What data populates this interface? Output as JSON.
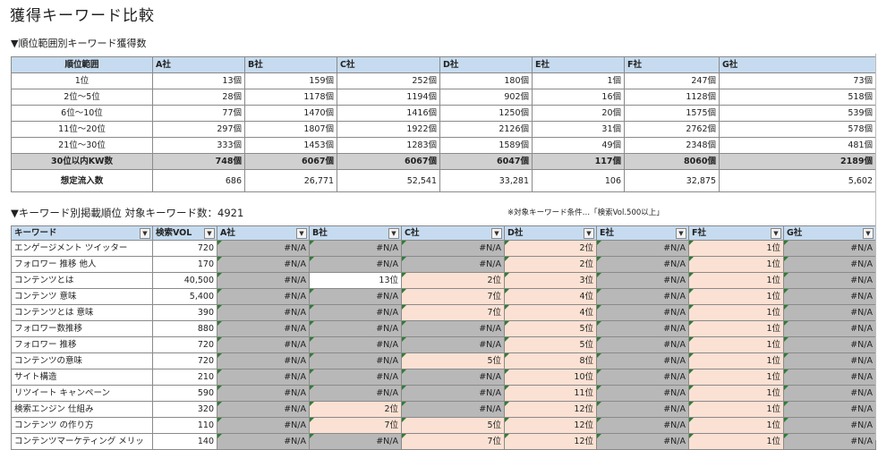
{
  "title": "獲得キーワード比較",
  "section1_title": "▼順位範囲別キーワード獲得数",
  "section2_title": "▼キーワード別掲載順位 対象キーワード数：4921",
  "note": "※対象キーワード条件…「検索Vol.500以上」",
  "colors": {
    "header": "#c6dbef",
    "na": "#b8b8b8",
    "rank": "#fbe1d3",
    "sum": "#d0d0d0"
  },
  "table1": {
    "headers": [
      "順位範囲",
      "A社",
      "B社",
      "C社",
      "D社",
      "E社",
      "F社",
      "G社"
    ],
    "rows": [
      [
        "1位",
        "13個",
        "159個",
        "252個",
        "180個",
        "1個",
        "247個",
        "73個"
      ],
      [
        "2位～5位",
        "28個",
        "1178個",
        "1194個",
        "902個",
        "16個",
        "1128個",
        "518個"
      ],
      [
        "6位～10位",
        "77個",
        "1470個",
        "1416個",
        "1250個",
        "20個",
        "1575個",
        "539個"
      ],
      [
        "11位～20位",
        "297個",
        "1807個",
        "1922個",
        "2126個",
        "31個",
        "2762個",
        "578個"
      ],
      [
        "21位～30位",
        "333個",
        "1453個",
        "1283個",
        "1589個",
        "49個",
        "2348個",
        "481個"
      ],
      [
        "30位以内KW数",
        "748個",
        "6067個",
        "6067個",
        "6047個",
        "117個",
        "8060個",
        "2189個"
      ],
      [
        "想定流入数",
        "686",
        "26,771",
        "52,541",
        "33,281",
        "106",
        "32,875",
        "5,602"
      ]
    ]
  },
  "table2": {
    "headers": [
      "キーワード",
      "検索VOL",
      "A社",
      "B社",
      "C社",
      "D社",
      "E社",
      "F社",
      "G社"
    ],
    "rows": [
      [
        "エンゲージメント ツイッター",
        "720",
        "#N/A",
        "#N/A",
        "#N/A",
        "2位",
        "#N/A",
        "1位",
        "#N/A"
      ],
      [
        "フォロワー 推移 他人",
        "170",
        "#N/A",
        "#N/A",
        "#N/A",
        "2位",
        "#N/A",
        "1位",
        "#N/A"
      ],
      [
        "コンテンツとは",
        "40,500",
        "#N/A",
        "13位",
        "2位",
        "3位",
        "#N/A",
        "1位",
        "#N/A"
      ],
      [
        "コンテンツ 意味",
        "5,400",
        "#N/A",
        "#N/A",
        "7位",
        "4位",
        "#N/A",
        "1位",
        "#N/A"
      ],
      [
        "コンテンツとは 意味",
        "390",
        "#N/A",
        "#N/A",
        "7位",
        "4位",
        "#N/A",
        "1位",
        "#N/A"
      ],
      [
        "フォロワー数推移",
        "880",
        "#N/A",
        "#N/A",
        "#N/A",
        "5位",
        "#N/A",
        "1位",
        "#N/A"
      ],
      [
        "フォロワー 推移",
        "720",
        "#N/A",
        "#N/A",
        "#N/A",
        "5位",
        "#N/A",
        "1位",
        "#N/A"
      ],
      [
        "コンテンツの意味",
        "720",
        "#N/A",
        "#N/A",
        "5位",
        "8位",
        "#N/A",
        "1位",
        "#N/A"
      ],
      [
        "サイト構造",
        "210",
        "#N/A",
        "#N/A",
        "#N/A",
        "10位",
        "#N/A",
        "1位",
        "#N/A"
      ],
      [
        "リツイート キャンペーン",
        "590",
        "#N/A",
        "#N/A",
        "#N/A",
        "11位",
        "#N/A",
        "1位",
        "#N/A"
      ],
      [
        "検索エンジン 仕組み",
        "320",
        "#N/A",
        "2位",
        "#N/A",
        "12位",
        "#N/A",
        "1位",
        "#N/A"
      ],
      [
        "コンテンツ の作り方",
        "110",
        "#N/A",
        "7位",
        "5位",
        "12位",
        "#N/A",
        "1位",
        "#N/A"
      ],
      [
        "コンテンツマーケティング メリッ",
        "140",
        "#N/A",
        "#N/A",
        "7位",
        "12位",
        "#N/A",
        "1位",
        "#N/A"
      ]
    ]
  }
}
